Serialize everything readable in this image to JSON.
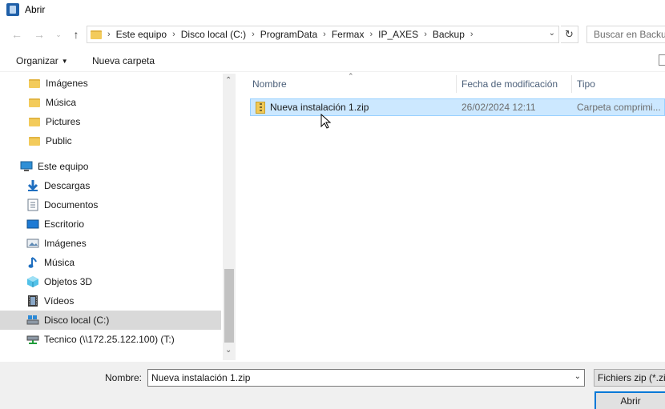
{
  "window": {
    "title": "Abrir",
    "icon": "app-dialog-icon"
  },
  "navigation": {
    "back_icon": "arrow-left-icon",
    "forward_icon": "arrow-right-icon",
    "dropdown_icon": "chevron-down-icon",
    "up_icon": "arrow-up-icon"
  },
  "address": {
    "breadcrumbs": [
      "Este equipo",
      "Disco local (C:)",
      "ProgramData",
      "Fermax",
      "IP_AXES",
      "Backup"
    ],
    "separator": "›"
  },
  "search": {
    "placeholder": "Buscar en Backup"
  },
  "toolbar": {
    "organize_label": "Organizar",
    "new_folder_label": "Nueva carpeta"
  },
  "sidebar": {
    "items": [
      {
        "label": "Imágenes",
        "icon": "folder-icon"
      },
      {
        "label": "Música",
        "icon": "folder-icon"
      },
      {
        "label": "Pictures",
        "icon": "folder-icon"
      },
      {
        "label": "Public",
        "icon": "folder-icon"
      },
      {
        "label": "Este equipo",
        "icon": "computer-icon"
      },
      {
        "label": "Descargas",
        "icon": "download-icon"
      },
      {
        "label": "Documentos",
        "icon": "documents-icon"
      },
      {
        "label": "Escritorio",
        "icon": "desktop-icon"
      },
      {
        "label": "Imágenes",
        "icon": "pictures-icon"
      },
      {
        "label": "Música",
        "icon": "music-icon"
      },
      {
        "label": "Objetos 3D",
        "icon": "objects-3d-icon"
      },
      {
        "label": "Vídeos",
        "icon": "videos-icon"
      },
      {
        "label": "Disco local (C:)",
        "icon": "local-disk-icon",
        "selected": true
      },
      {
        "label": "Tecnico (\\\\172.25.122.100) (T:)",
        "icon": "network-drive-icon"
      }
    ]
  },
  "columns": {
    "name": "Nombre",
    "modified": "Fecha de modificación",
    "type": "Tipo"
  },
  "files": [
    {
      "name": "Nueva instalación 1.zip",
      "modified": "26/02/2024 12:11",
      "type": "Carpeta comprimi...",
      "icon": "zip-folder-icon",
      "selected": true
    }
  ],
  "footer": {
    "filename_label": "Nombre:",
    "filename_value": "Nueva instalación 1.zip",
    "filter_value": "Fichiers zip (*.zip)",
    "open_label": "Abrir"
  },
  "colors": {
    "selection": "#cce8ff",
    "selection_border": "#99d1ff",
    "accent": "#0078d7",
    "folder": "#f3cb5b"
  }
}
